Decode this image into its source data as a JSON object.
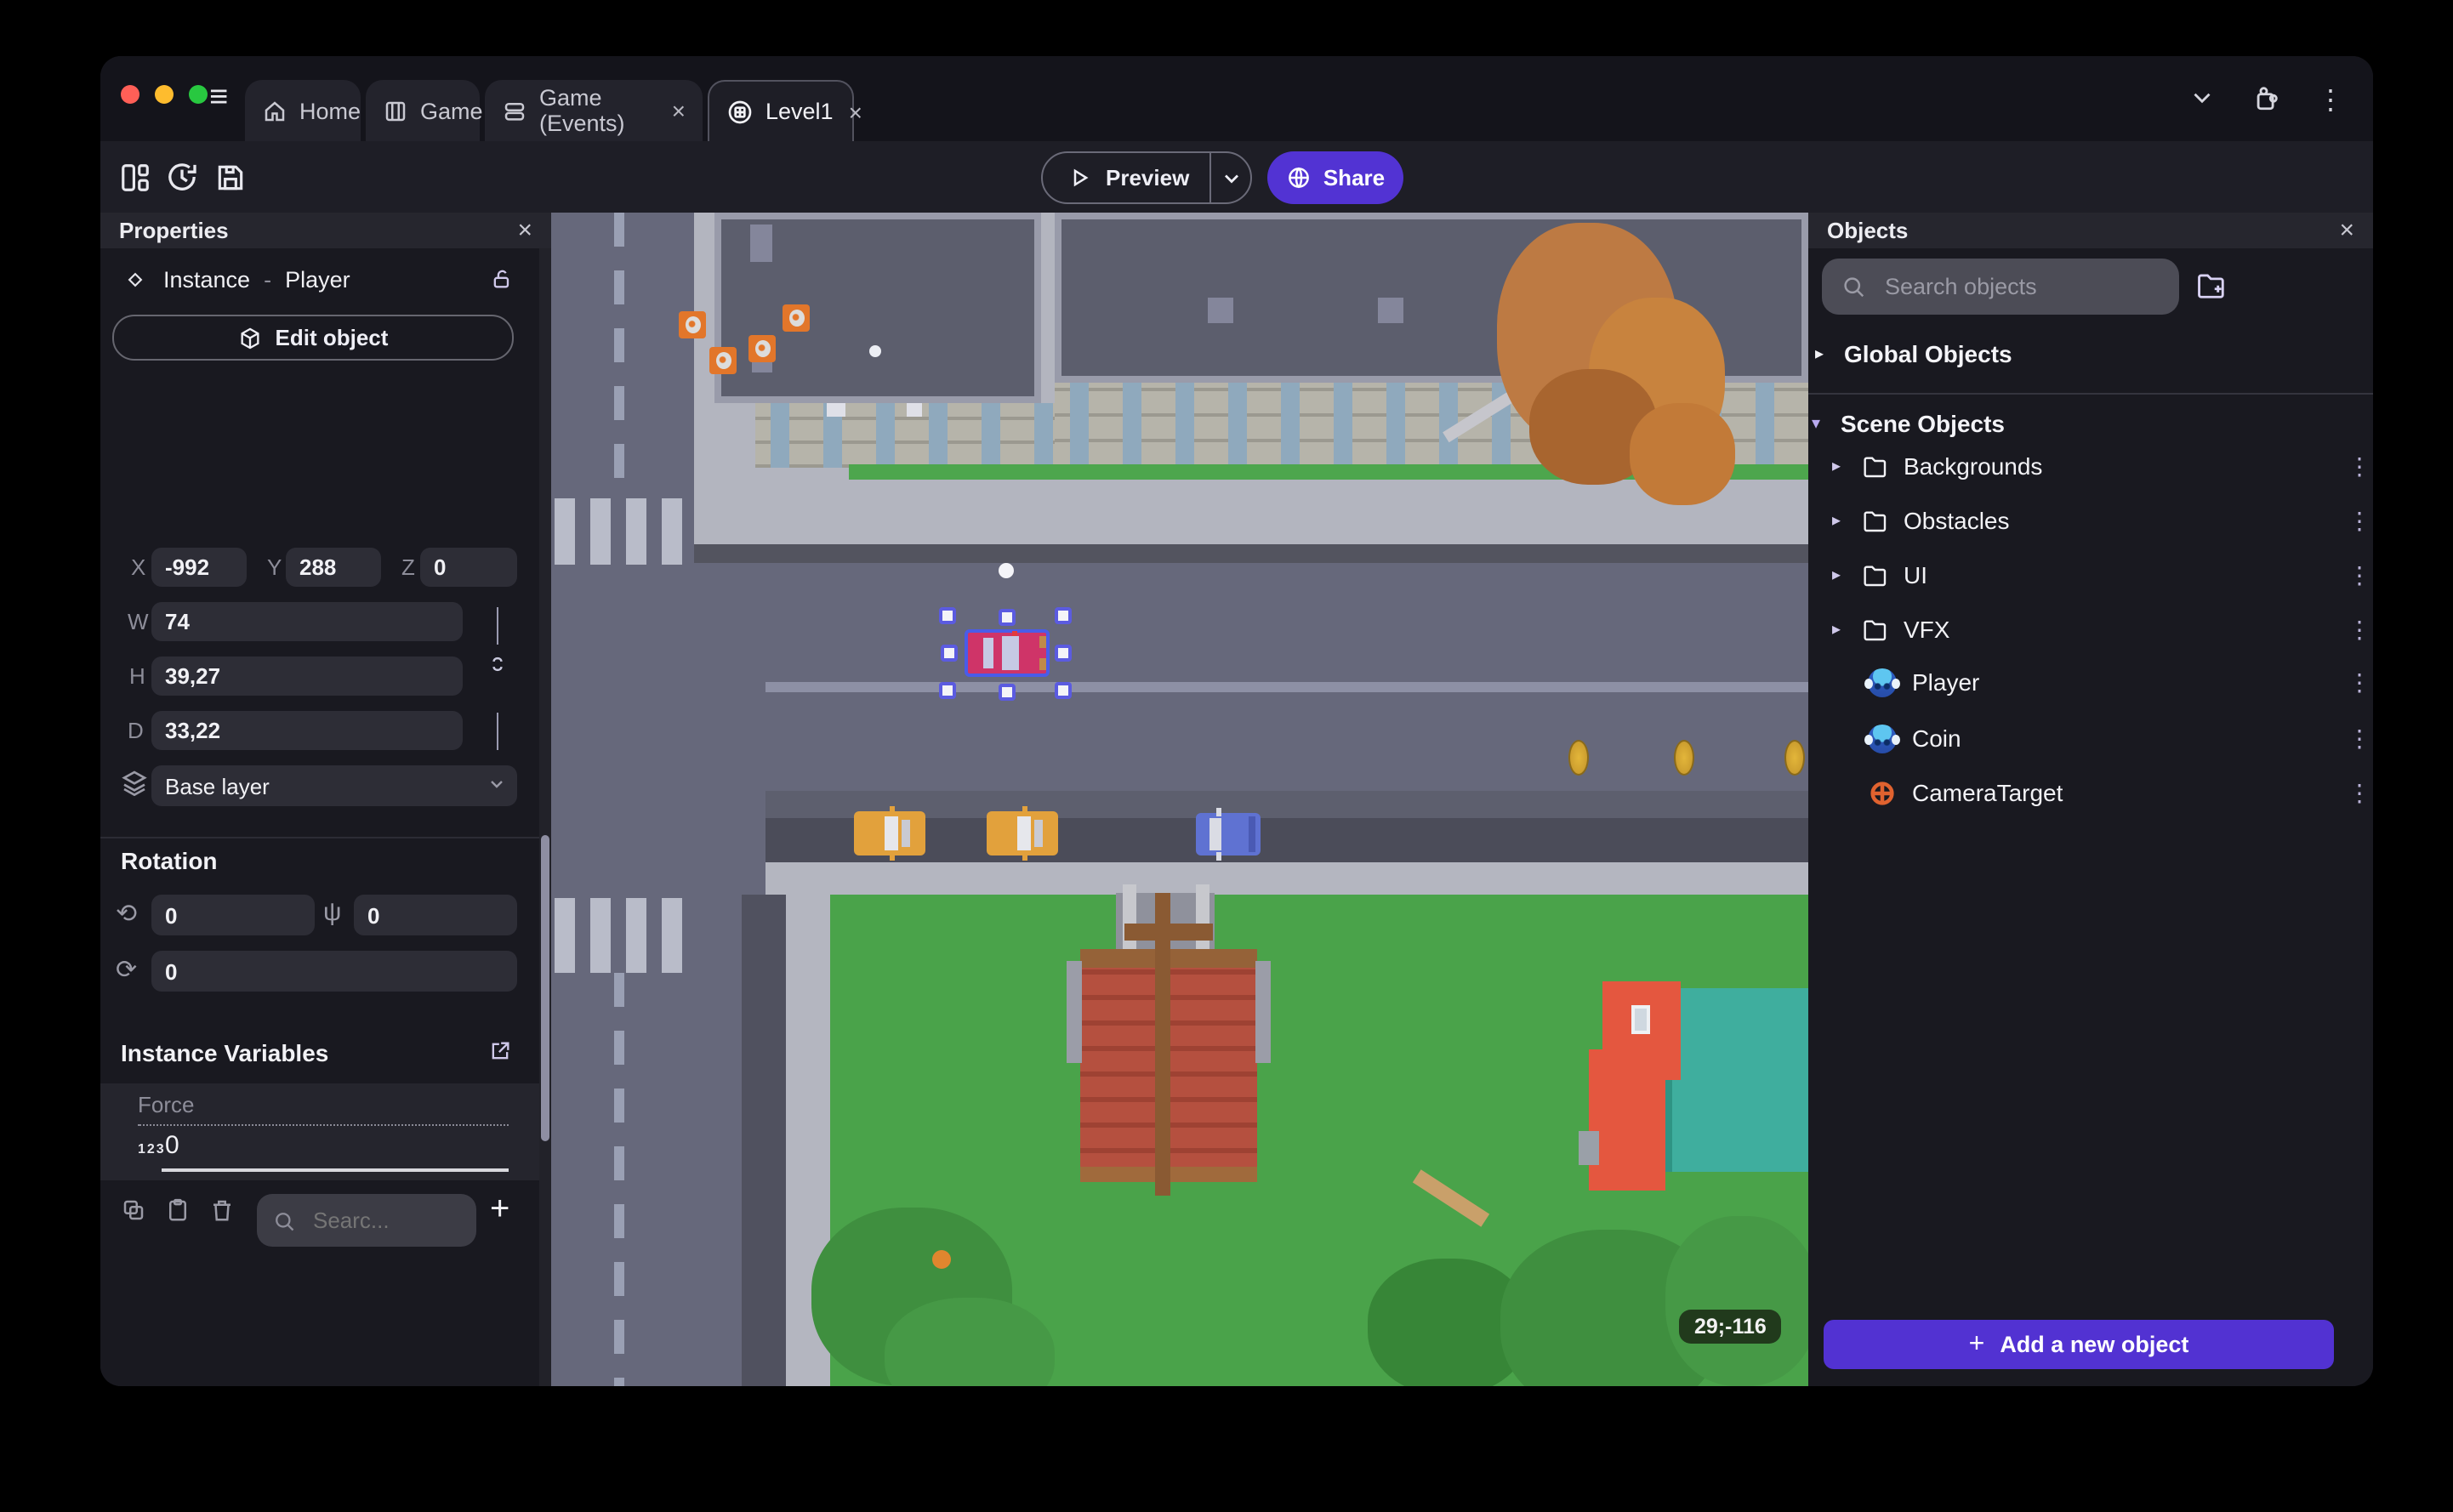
{
  "titlebar": {
    "tabs": [
      {
        "label": "Home"
      },
      {
        "label": "Game"
      },
      {
        "label": "Game (Events)"
      },
      {
        "label": "Level1"
      }
    ]
  },
  "icons": {
    "close": "×",
    "kebab": "⋮",
    "caret_right": "▸",
    "caret_down": "▾",
    "hamburger": "≡",
    "plus": "+",
    "grid": "#",
    "undo": "↶",
    "redo": "↷",
    "rot_x": "⟲",
    "rot_y": "ψ",
    "rot_z": "⟳"
  },
  "toolbar": {
    "preview_label": "Preview",
    "share_label": "Share"
  },
  "properties": {
    "title": "Properties",
    "instance_type": "Instance",
    "separator": "-",
    "instance_name": "Player",
    "edit_object_label": "Edit object",
    "position": {
      "x_label": "X",
      "x": "-992",
      "y_label": "Y",
      "y": "288",
      "z_label": "Z",
      "z": "0"
    },
    "size": {
      "w_label": "W",
      "w": "74",
      "h_label": "H",
      "h": "39,27",
      "d_label": "D",
      "d": "33,22"
    },
    "layer": "Base layer",
    "rotation_title": "Rotation",
    "rotation": {
      "x": "0",
      "y": "0",
      "z": "0"
    },
    "variables_title": "Instance Variables",
    "variable": {
      "name": "Force",
      "type_label": "123",
      "value": "0"
    },
    "search_placeholder": "Searc..."
  },
  "objects": {
    "title": "Objects",
    "search_placeholder": "Search objects",
    "global_label": "Global Objects",
    "scene_label": "Scene Objects",
    "folders": [
      {
        "label": "Backgrounds"
      },
      {
        "label": "Obstacles"
      },
      {
        "label": "UI"
      },
      {
        "label": "VFX"
      }
    ],
    "items": [
      {
        "label": "Player",
        "icon": "monkey-icon"
      },
      {
        "label": "Coin",
        "icon": "monkey-icon"
      },
      {
        "label": "CameraTarget",
        "icon": "camera-target-icon"
      }
    ],
    "add_button_label": "Add a new object"
  },
  "canvas": {
    "coords_badge": "29;-116"
  },
  "colors": {
    "accent_purple": "#5233d3",
    "accent_lavender": "#b5a7ef",
    "selection_blue": "#4a5ce8",
    "grass_green": "#4aa34a",
    "road_gray": "#66687b",
    "sidewalk_gray": "#b4b6c0",
    "crate_orange": "#e2762a",
    "coin_gold": "#d9a929",
    "car_selected_pink": "#cf3468",
    "car_yellow": "#e2a13c",
    "car_blue": "#5f72d2",
    "camera_target_orange": "#e0622f",
    "unsaved_dot_orange": "#ef7d57"
  }
}
